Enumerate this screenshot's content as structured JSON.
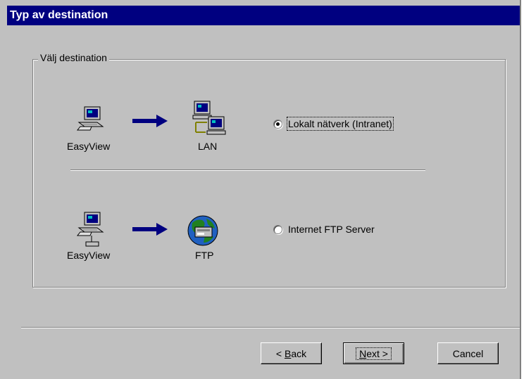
{
  "title": "Typ av destination",
  "group": {
    "label": "Välj destination"
  },
  "options": [
    {
      "source_label": "EasyView",
      "target_label": "LAN",
      "radio_label": "Lokalt nätverk (Intranet)",
      "selected": true,
      "source_icon": "computer-icon",
      "arrow_icon": "arrow-right-icon",
      "target_icon": "network-computers-icon"
    },
    {
      "source_label": "EasyView",
      "target_label": "FTP",
      "radio_label": "Internet FTP Server",
      "selected": false,
      "source_icon": "computer-icon",
      "arrow_icon": "arrow-right-icon",
      "target_icon": "globe-ftp-icon"
    }
  ],
  "buttons": {
    "back_prefix": "< ",
    "back_mnemonic": "B",
    "back_rest": "ack",
    "next_mnemonic": "N",
    "next_rest": "ext >",
    "cancel": "Cancel"
  },
  "colors": {
    "face": "#c0c0c0",
    "titlebar": "#000080",
    "arrow": "#000080"
  }
}
